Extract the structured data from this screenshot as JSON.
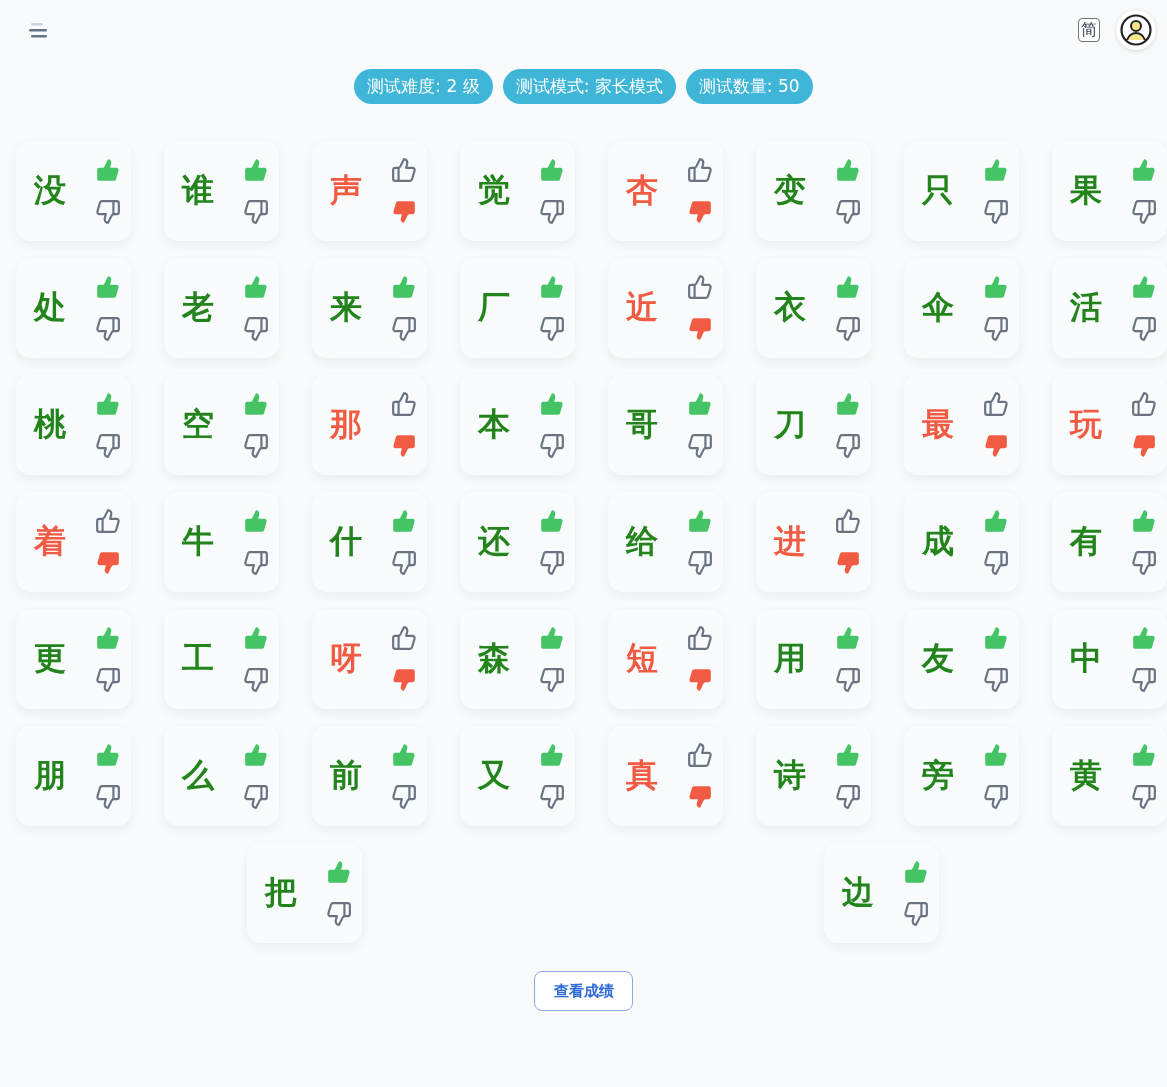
{
  "header": {
    "language_toggle": "简"
  },
  "badges": [
    "测试难度: 2 级",
    "测试模式: 家长模式",
    "测试数量: 50"
  ],
  "cards": [
    {
      "char": "没",
      "correct": true
    },
    {
      "char": "谁",
      "correct": true
    },
    {
      "char": "声",
      "correct": false
    },
    {
      "char": "觉",
      "correct": true
    },
    {
      "char": "杏",
      "correct": false
    },
    {
      "char": "变",
      "correct": true
    },
    {
      "char": "只",
      "correct": true
    },
    {
      "char": "果",
      "correct": true
    },
    {
      "char": "处",
      "correct": true
    },
    {
      "char": "老",
      "correct": true
    },
    {
      "char": "来",
      "correct": true
    },
    {
      "char": "厂",
      "correct": true
    },
    {
      "char": "近",
      "correct": false
    },
    {
      "char": "衣",
      "correct": true
    },
    {
      "char": "伞",
      "correct": true
    },
    {
      "char": "活",
      "correct": true
    },
    {
      "char": "桃",
      "correct": true
    },
    {
      "char": "空",
      "correct": true
    },
    {
      "char": "那",
      "correct": false
    },
    {
      "char": "本",
      "correct": true
    },
    {
      "char": "哥",
      "correct": true
    },
    {
      "char": "刀",
      "correct": true
    },
    {
      "char": "最",
      "correct": false
    },
    {
      "char": "玩",
      "correct": false
    },
    {
      "char": "着",
      "correct": false
    },
    {
      "char": "牛",
      "correct": true
    },
    {
      "char": "什",
      "correct": true
    },
    {
      "char": "还",
      "correct": true
    },
    {
      "char": "给",
      "correct": true
    },
    {
      "char": "进",
      "correct": false
    },
    {
      "char": "成",
      "correct": true
    },
    {
      "char": "有",
      "correct": true
    },
    {
      "char": "更",
      "correct": true
    },
    {
      "char": "工",
      "correct": true
    },
    {
      "char": "呀",
      "correct": false
    },
    {
      "char": "森",
      "correct": true
    },
    {
      "char": "短",
      "correct": false
    },
    {
      "char": "用",
      "correct": true
    },
    {
      "char": "友",
      "correct": true
    },
    {
      "char": "中",
      "correct": true
    },
    {
      "char": "朋",
      "correct": true
    },
    {
      "char": "么",
      "correct": true
    },
    {
      "char": "前",
      "correct": true
    },
    {
      "char": "又",
      "correct": true
    },
    {
      "char": "真",
      "correct": false
    },
    {
      "char": "诗",
      "correct": true
    },
    {
      "char": "旁",
      "correct": true
    },
    {
      "char": "黄",
      "correct": true
    },
    {
      "char": "把",
      "correct": true
    },
    {
      "char": "边",
      "correct": true
    }
  ],
  "results_button": "查看成绩"
}
